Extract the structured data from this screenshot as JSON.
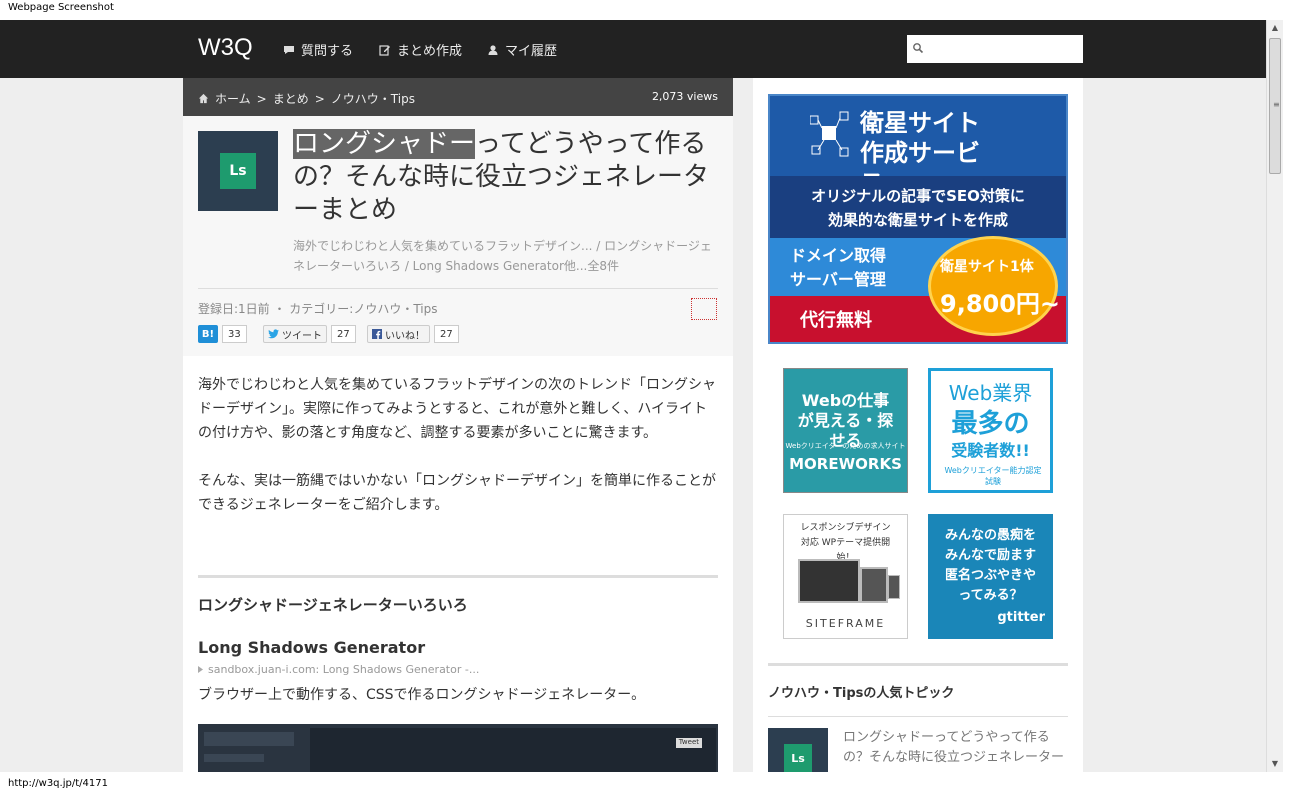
{
  "window": {
    "title": "Webpage Screenshot"
  },
  "header": {
    "logo": "W3Q",
    "nav": [
      {
        "label": "質問する",
        "icon": "speech-bubble-icon"
      },
      {
        "label": "まとめ作成",
        "icon": "edit-icon"
      },
      {
        "label": "マイ履歴",
        "icon": "user-icon"
      }
    ],
    "search": {
      "placeholder": ""
    }
  },
  "breadcrumb": {
    "items": [
      "ホーム",
      ">",
      "まとめ",
      ">",
      "ノウハウ・Tips"
    ],
    "views": "2,073 views"
  },
  "article": {
    "thumb_label": "Ls",
    "title_highlight": "ロングシャドー",
    "title_rest": "ってどうやって作るの？そんな時に役立つジェネレーターまとめ",
    "summary": "海外でじわじわと人気を集めているフラットデザイン... / ロングシャドージェネレーターいろいろ / Long Shadows Generator他...全8件",
    "meta": "登録日:1日前 ・ カテゴリー:ノウハウ・Tips",
    "social": {
      "hatena_label": "B!",
      "hatena_count": "33",
      "tweet_label": "ツイート",
      "tweet_count": "27",
      "like_label": "いいね！",
      "like_count": "27"
    },
    "intro": [
      "海外でじわじわと人気を集めているフラットデザインの次のトレンド「ロングシャドーデザイン」。実際に作ってみようとすると、これが意外と難しく、ハイライトの付け方や、影の落とす角度など、調整する要素が多いことに驚きます。",
      "そんな、実は一筋縄ではいかない「ロングシャドーデザイン」を簡単に作ることができるジェネレーターをご紹介します。"
    ],
    "section_heading": "ロングシャドージェネレーターいろいろ",
    "item": {
      "title": "Long Shadows Generator",
      "source": "sandbox.juan-i.com: Long Shadows Generator -...",
      "desc": "ブラウザー上で動作する、CSSで作るロングシャドージェネレーター。",
      "preview_tweet": "Tweet"
    }
  },
  "sidebar": {
    "ad_big": {
      "title": "衛星サイト作成サービス",
      "tagline_1": "オリジナルの記事でSEO対策に",
      "tagline_2": "効果的な衛星サイトを作成",
      "feature_1": "ドメイン取得",
      "feature_2": "サーバー管理",
      "free": "代行無料",
      "price_label": "衛星サイト1体",
      "price": "9,800円~"
    },
    "ad_moreworks": {
      "line1": "Webの仕事が見える・探せる",
      "line2": "Webクリエイターのための求人サイト",
      "line3": "MOREWORKS"
    },
    "ad_exam": {
      "line1": "Web業界",
      "line2": "最多の",
      "line3": "受験者数!!",
      "line4": "Webクリエイター能力認定試験"
    },
    "ad_siteframe": {
      "line1": "レスポンシブデザイン対応 WPテーマ提供開始！",
      "line2": "SITEFRAME"
    },
    "ad_gtitter": {
      "line1": "みんなの愚痴をみんなで励ます匿名つぶやきやってみる？",
      "line2": "gtitter"
    },
    "popular_heading": "ノウハウ・Tipsの人気トピック",
    "topic": {
      "thumb_label": "Ls",
      "text": "ロングシャドーってどうやって作るの？そんな時に役立つジェネレーター"
    }
  },
  "statusbar": {
    "url": "http://w3q.jp/t/4171"
  }
}
